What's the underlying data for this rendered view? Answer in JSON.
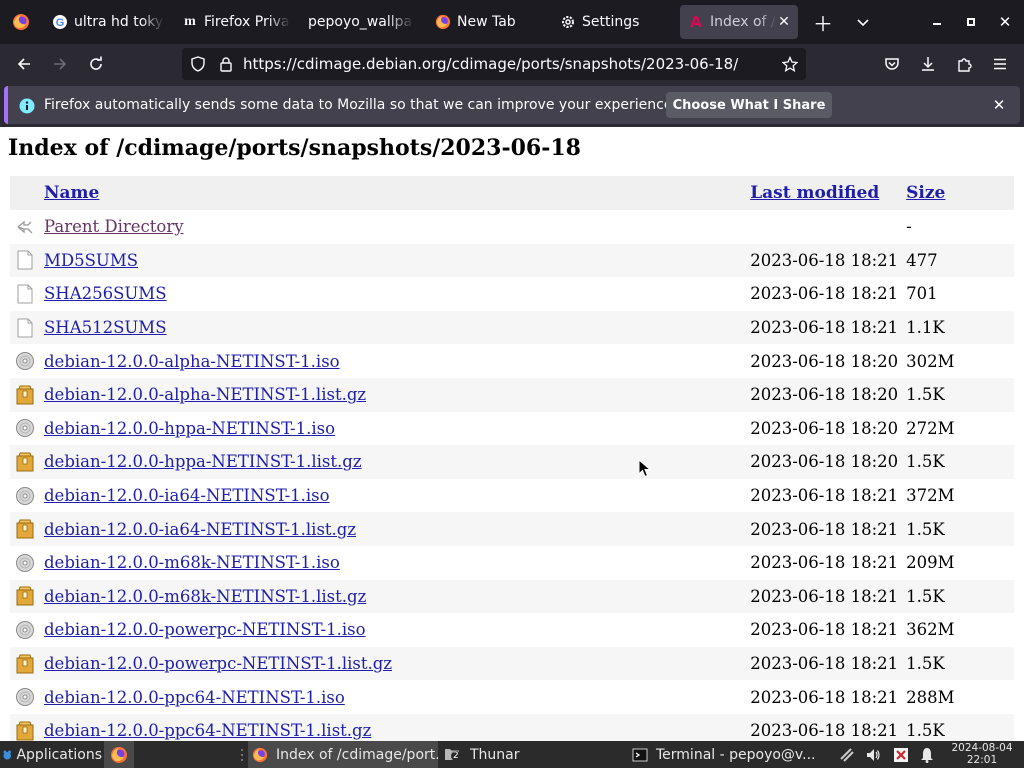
{
  "browser": {
    "tabs": [
      {
        "label": "ultra hd toky",
        "icon": "google-icon"
      },
      {
        "label": "Firefox Priva",
        "icon": "medium-icon"
      },
      {
        "label": "pepoyo_wallpa",
        "icon": "none"
      },
      {
        "label": "New Tab",
        "icon": "firefox-icon"
      },
      {
        "label": "Settings",
        "icon": "gear-icon"
      },
      {
        "label": "Index of /cd",
        "icon": "debian-icon",
        "active": true
      }
    ],
    "url": "https://cdimage.debian.org/cdimage/ports/snapshots/2023-06-18/"
  },
  "notification": {
    "message": "Firefox automatically sends some data to Mozilla so that we can improve your experience.",
    "button": "Choose What I Share"
  },
  "page": {
    "title": "Index of /cdimage/ports/snapshots/2023-06-18",
    "columns": {
      "name": "Name",
      "modified": "Last modified",
      "size": "Size"
    },
    "parent": {
      "name": "Parent Directory",
      "modified": "",
      "size": "-"
    },
    "files": [
      {
        "name": "MD5SUMS",
        "modified": "2023-06-18 18:21",
        "size": "477",
        "type": "text"
      },
      {
        "name": "SHA256SUMS",
        "modified": "2023-06-18 18:21",
        "size": "701",
        "type": "text"
      },
      {
        "name": "SHA512SUMS",
        "modified": "2023-06-18 18:21",
        "size": "1.1K",
        "type": "text"
      },
      {
        "name": "debian-12.0.0-alpha-NETINST-1.iso",
        "modified": "2023-06-18 18:20",
        "size": "302M",
        "type": "disc"
      },
      {
        "name": "debian-12.0.0-alpha-NETINST-1.list.gz",
        "modified": "2023-06-18 18:20",
        "size": "1.5K",
        "type": "archive"
      },
      {
        "name": "debian-12.0.0-hppa-NETINST-1.iso",
        "modified": "2023-06-18 18:20",
        "size": "272M",
        "type": "disc"
      },
      {
        "name": "debian-12.0.0-hppa-NETINST-1.list.gz",
        "modified": "2023-06-18 18:20",
        "size": "1.5K",
        "type": "archive"
      },
      {
        "name": "debian-12.0.0-ia64-NETINST-1.iso",
        "modified": "2023-06-18 18:21",
        "size": "372M",
        "type": "disc"
      },
      {
        "name": "debian-12.0.0-ia64-NETINST-1.list.gz",
        "modified": "2023-06-18 18:21",
        "size": "1.5K",
        "type": "archive"
      },
      {
        "name": "debian-12.0.0-m68k-NETINST-1.iso",
        "modified": "2023-06-18 18:21",
        "size": "209M",
        "type": "disc"
      },
      {
        "name": "debian-12.0.0-m68k-NETINST-1.list.gz",
        "modified": "2023-06-18 18:21",
        "size": "1.5K",
        "type": "archive"
      },
      {
        "name": "debian-12.0.0-powerpc-NETINST-1.iso",
        "modified": "2023-06-18 18:21",
        "size": "362M",
        "type": "disc"
      },
      {
        "name": "debian-12.0.0-powerpc-NETINST-1.list.gz",
        "modified": "2023-06-18 18:21",
        "size": "1.5K",
        "type": "archive"
      },
      {
        "name": "debian-12.0.0-ppc64-NETINST-1.iso",
        "modified": "2023-06-18 18:21",
        "size": "288M",
        "type": "disc"
      },
      {
        "name": "debian-12.0.0-ppc64-NETINST-1.list.gz",
        "modified": "2023-06-18 18:21",
        "size": "1.5K",
        "type": "archive"
      }
    ]
  },
  "taskbar": {
    "applications": "Applications",
    "windows": [
      {
        "label": "Index of /cdimage/port...",
        "icon": "firefox-icon"
      },
      {
        "label": "Thunar",
        "icon": "folder-icon",
        "badge": "2"
      },
      {
        "label": "Terminal - pepoyo@v...",
        "icon": "terminal-icon"
      }
    ],
    "clock": {
      "date": "2024-08-04",
      "time": "22:01"
    }
  },
  "colors": {
    "tabbar_bg": "#1c1b22",
    "navbar_bg": "#2b2a33",
    "link": "#1e1eaa",
    "visited_link": "#663366",
    "notification_accent": "#a372f8"
  }
}
